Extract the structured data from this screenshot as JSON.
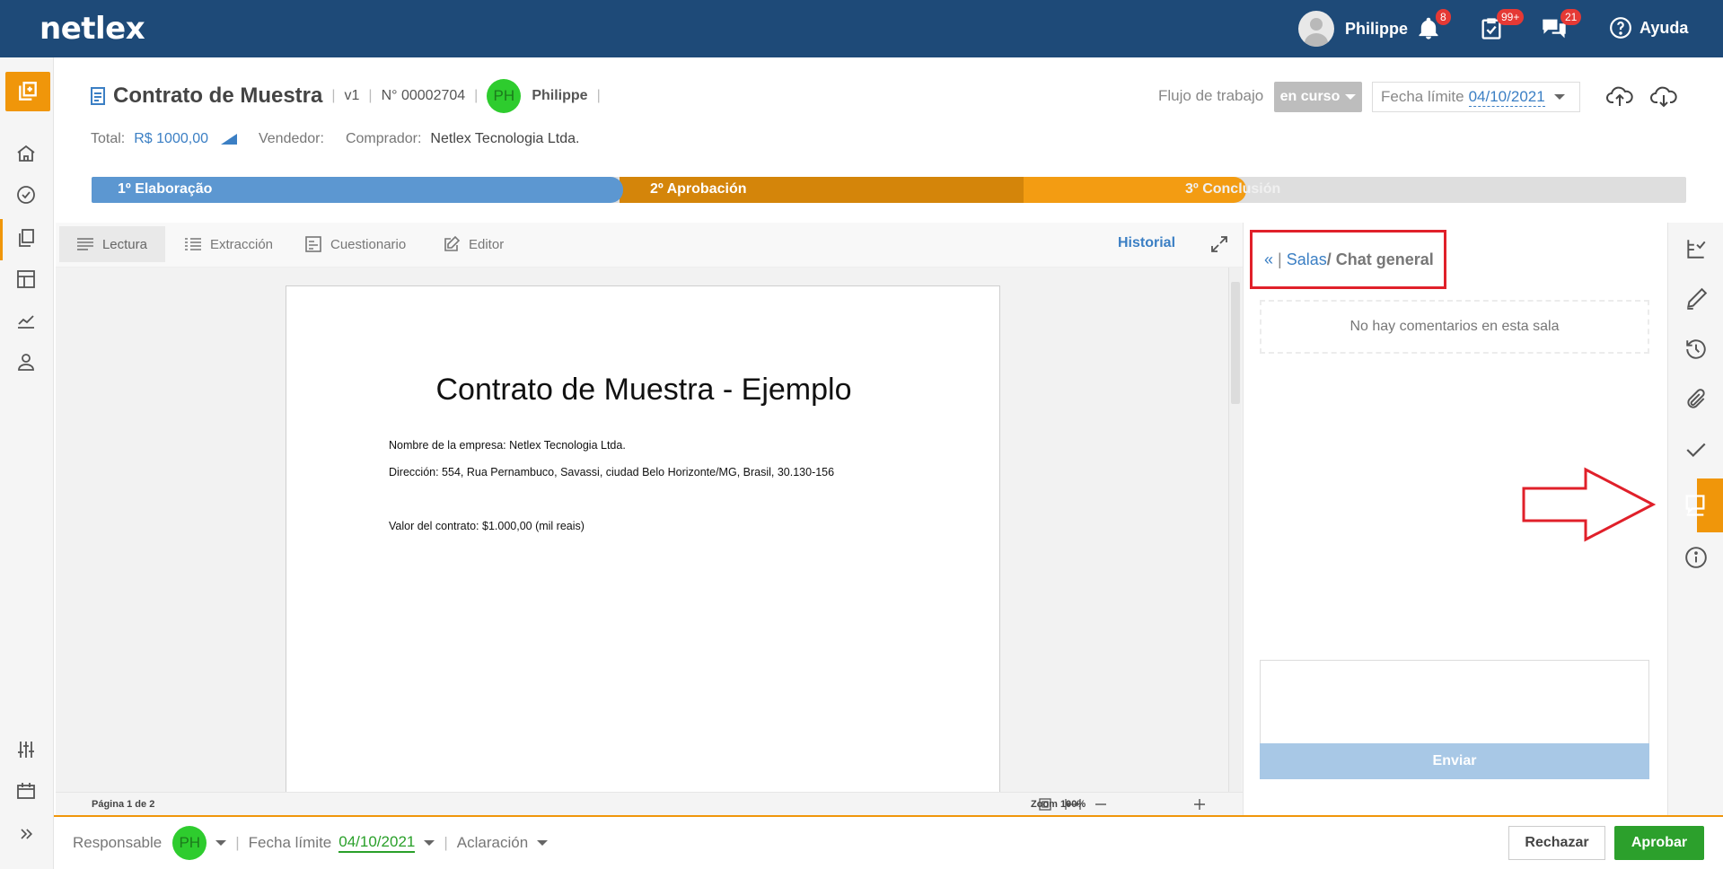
{
  "topbar": {
    "logo": "netlex",
    "user_name": "Philippe",
    "notifications_badge": "8",
    "tasks_badge": "99+",
    "messages_badge": "21",
    "help_label": "Ayuda"
  },
  "document": {
    "title": "Contrato de Muestra",
    "version": "v1",
    "number": "N° 00002704",
    "owner_initials": "PH",
    "owner_name": "Philippe",
    "total_label": "Total:",
    "total_value": "R$ 1000,00",
    "seller_label": "Vendedor:",
    "buyer_label": "Comprador:",
    "buyer_value": "Netlex Tecnologia Ltda."
  },
  "workflow": {
    "label": "Flujo de trabajo",
    "status": "en curso",
    "deadline_label": "Fecha límite",
    "deadline_value": "04/10/2021"
  },
  "stages": [
    {
      "label": "1º Elaboração",
      "color": "#5c97d1"
    },
    {
      "label": "2º Aprobación",
      "color": "#f39c12"
    },
    {
      "label": "3º Conclusión",
      "color": "#dedede"
    }
  ],
  "tabs": [
    {
      "label": "Lectura",
      "active": true
    },
    {
      "label": "Extracción",
      "active": false
    },
    {
      "label": "Cuestionario",
      "active": false
    },
    {
      "label": "Editor",
      "active": false
    }
  ],
  "historial_label": "Historial",
  "page_content": {
    "heading": "Contrato de Muestra - Ejemplo",
    "line1": "Nombre de la empresa: Netlex Tecnologia Ltda.",
    "line2": "Dirección: 554, Rua Pernambuco, Savassi, ciudad Belo Horizonte/MG, Brasil, 30.130-156",
    "line3": "Valor del contrato: $1.000,00 (mil reais)"
  },
  "statusbar": {
    "page_info": "Página 1 de 2",
    "zoom": "Zoom 100%"
  },
  "chat": {
    "back": "«",
    "separator": "|",
    "rooms_link": "Salas",
    "room_name": "/ Chat general",
    "empty_message": "No hay comentarios en esta sala",
    "send_label": "Enviar"
  },
  "footer": {
    "responsible_label": "Responsable",
    "responsible_initials": "PH",
    "deadline_label": "Fecha límite",
    "deadline_value": "04/10/2021",
    "clarification_label": "Aclaración",
    "reject_label": "Rechazar",
    "approve_label": "Aprobar"
  },
  "colors": {
    "topbar": "#1e4a78",
    "accent": "#f0960a",
    "link": "#3b7fc4",
    "approve": "#2ca02c",
    "annotation": "#e0202a"
  }
}
